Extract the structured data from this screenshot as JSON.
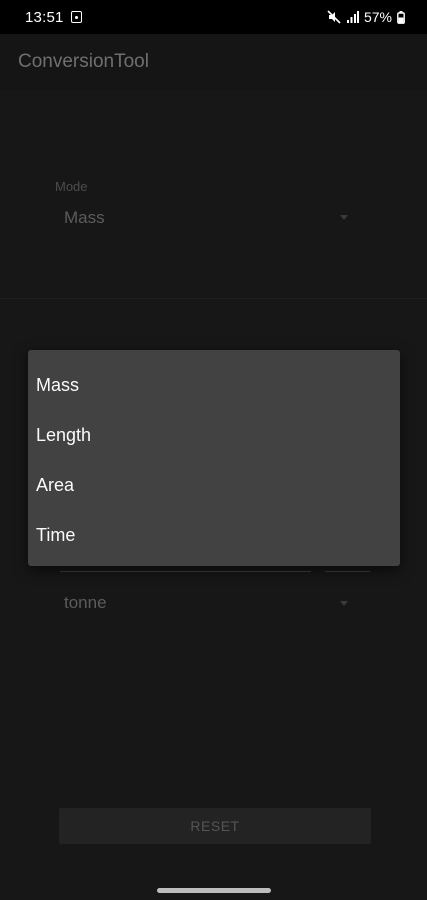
{
  "status_bar": {
    "time": "13:51",
    "battery": "57%"
  },
  "app_bar": {
    "title": "ConversionTool"
  },
  "mode": {
    "label": "Mode",
    "selected": "Mass"
  },
  "unit": {
    "selected": "tonne"
  },
  "popup": {
    "options": [
      "Mass",
      "Length",
      "Area",
      "Time"
    ]
  },
  "reset_button": {
    "label": "RESET"
  }
}
